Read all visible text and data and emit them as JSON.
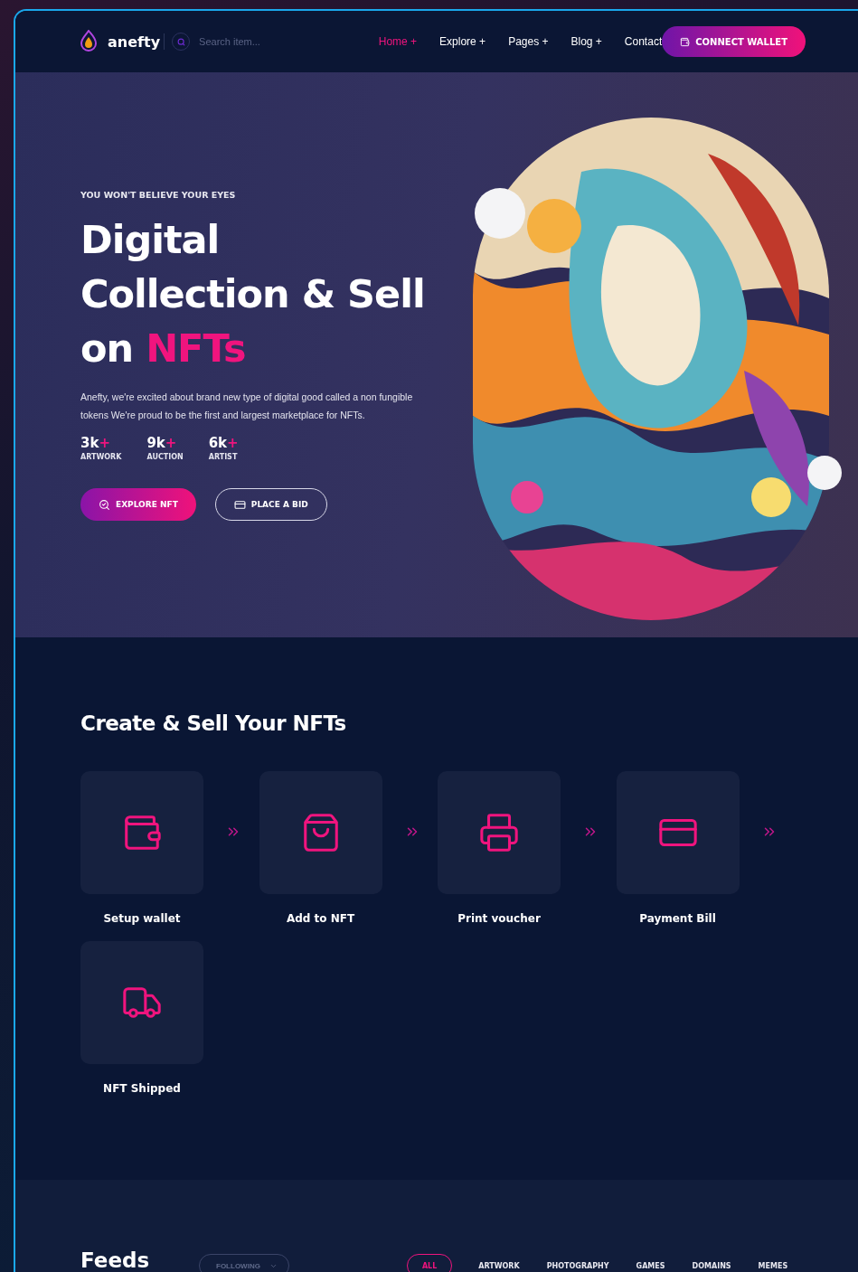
{
  "header": {
    "logo": "anefty",
    "search": {
      "placeholder": "Search item..."
    },
    "nav": [
      {
        "label": "Home +",
        "selected": true
      },
      {
        "label": "Explore +",
        "selected": false
      },
      {
        "label": "Pages +",
        "selected": false
      },
      {
        "label": "Blog +",
        "selected": false
      },
      {
        "label": "Contact",
        "selected": false
      }
    ],
    "cta": "CONNECT WALLET"
  },
  "hero": {
    "eyebrow": "YOU WON'T BELIEVE YOUR EYES",
    "title_lines": [
      {
        "text": "Digital"
      },
      {
        "text": "Collection & Sell"
      },
      {
        "text": "on ",
        "highlight": "NFTs"
      }
    ],
    "description": "Anefty, we're excited about brand new type of digital good called a non fungible tokens We're proud to be the first and largest marketplace for NFTs.",
    "stats": [
      {
        "value": "3k",
        "suffix": "+",
        "label": "ARTWORK"
      },
      {
        "value": "9k",
        "suffix": "+",
        "label": "AUCTION"
      },
      {
        "value": "6k",
        "suffix": "+",
        "label": "ARTIST"
      }
    ],
    "buttons": [
      {
        "kind": "primary",
        "label": "EXPLORE NFT"
      },
      {
        "kind": "outline",
        "label": "PLACE A BID"
      }
    ]
  },
  "steps": {
    "title": "Create & Sell Your NFTs",
    "items": [
      {
        "label": "Setup wallet"
      },
      {
        "label": "Add to NFT"
      },
      {
        "label": "Print voucher"
      },
      {
        "label": "Payment Bill"
      },
      {
        "label": "NFT Shipped"
      }
    ]
  },
  "feeds": {
    "title": "Feeds",
    "filter": "FOLLOWING",
    "tabs": [
      {
        "label": "ALL",
        "selected": true
      },
      {
        "label": "ARTWORK",
        "selected": false
      },
      {
        "label": "PHOTOGRAPHY",
        "selected": false
      },
      {
        "label": "GAMES",
        "selected": false
      },
      {
        "label": "DOMAINS",
        "selected": false
      },
      {
        "label": "MEMES",
        "selected": false
      }
    ]
  }
}
